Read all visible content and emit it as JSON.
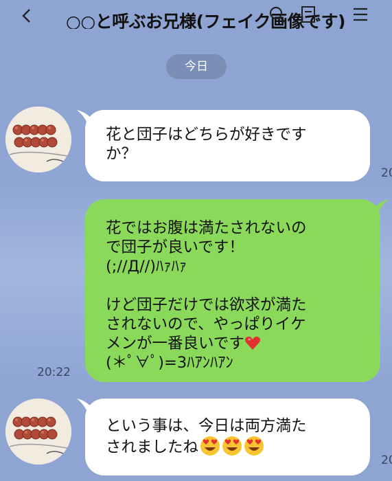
{
  "header": {
    "title": "○○と呼ぶお兄様(フェイク画像です)",
    "back_icon": "chevron-left-icon",
    "search_icon": "search-icon",
    "note_icon": "note-icon",
    "menu_icon": "menu-icon"
  },
  "date_label": "今日",
  "messages": [
    {
      "side": "in",
      "text": "花と団子はどちらが好きです\nか？",
      "time": "20"
    },
    {
      "side": "out",
      "text_part1": "花ではお腹は満たされないの\nで団子が良いです！\n(;//Д//)ﾊｧﾊｧ\n\nけど団子だけでは欲求が満た\nされないので、やっぱりイケ\nメンが一番良いです",
      "text_part2": "\n(＊ﾟ∀ﾟ)=3ﾊｱﾝﾊｱﾝ",
      "time": "20:22"
    },
    {
      "side": "in",
      "text": "という事は、今日は両方満た\nされましたね",
      "emoji_count": 3,
      "time": "20"
    }
  ],
  "colors": {
    "background": "#8ea5d4",
    "incoming_bubble": "#ffffff",
    "outgoing_bubble": "#8bd95b",
    "date_pill": "#7b8fb6"
  }
}
